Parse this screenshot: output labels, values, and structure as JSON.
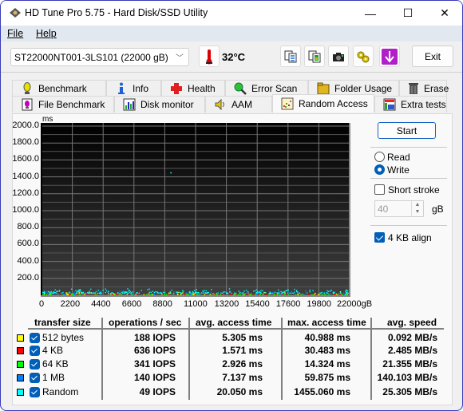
{
  "window": {
    "title": "HD Tune Pro 5.75 - Hard Disk/SSD Utility",
    "controls": {
      "minimize": "—",
      "maximize": "☐",
      "close": "✕"
    }
  },
  "menu": [
    {
      "label": "File",
      "accel": "F"
    },
    {
      "label": "Help",
      "accel": "H"
    }
  ],
  "toolbar": {
    "drive": "ST22000NT001-3LS101 (22000 gB)",
    "temperature": "32°C",
    "icons": [
      "copy-text-icon",
      "copy-image-icon",
      "screenshot-camera-icon",
      "settings-gears-icon",
      "save-download-icon"
    ],
    "exit_label": "Exit"
  },
  "tabs": {
    "row1": [
      {
        "label": "Benchmark",
        "icon": "benchmark-icon"
      },
      {
        "label": "Info",
        "icon": "info-icon"
      },
      {
        "label": "Health",
        "icon": "health-icon"
      },
      {
        "label": "Error Scan",
        "icon": "error-scan-icon"
      },
      {
        "label": "Folder Usage",
        "icon": "folder-icon"
      },
      {
        "label": "Erase",
        "icon": "trash-icon"
      }
    ],
    "row2": [
      {
        "label": "File Benchmark",
        "icon": "file-benchmark-icon"
      },
      {
        "label": "Disk monitor",
        "icon": "disk-monitor-icon"
      },
      {
        "label": "AAM",
        "icon": "speaker-icon"
      },
      {
        "label": "Random Access",
        "icon": "random-access-icon",
        "active": true
      },
      {
        "label": "Extra tests",
        "icon": "extra-tests-icon"
      }
    ]
  },
  "controls": {
    "start_label": "Start",
    "mode_options": [
      {
        "label": "Read",
        "selected": false
      },
      {
        "label": "Write",
        "selected": true
      }
    ],
    "short_stroke": {
      "label": "Short stroke",
      "checked": false
    },
    "short_stroke_value": "40",
    "short_stroke_unit": "gB",
    "align_4kb": {
      "label": "4 KB align",
      "checked": true
    }
  },
  "chart_data": {
    "type": "scatter",
    "title": "",
    "ylabel": "ms",
    "xlabel": "gB",
    "ylim": [
      0,
      2000
    ],
    "xlim": [
      0,
      22000
    ],
    "y_ticks": [
      "2000.0",
      "1800.0",
      "1600.0",
      "1400.0",
      "1200.0",
      "1000.0",
      "800.0",
      "600.0",
      "400.0",
      "200.0"
    ],
    "x_ticks": [
      "0",
      "2200",
      "4400",
      "6600",
      "8800",
      "11000",
      "13200",
      "15400",
      "17600",
      "19800",
      "22000gB"
    ],
    "grid": true,
    "series": [
      {
        "name": "512 bytes",
        "color": "#ffff00",
        "typical_ms": 5.3,
        "max_ms": 41.0
      },
      {
        "name": "4 KB",
        "color": "#ff0000",
        "typical_ms": 1.6,
        "max_ms": 30.5
      },
      {
        "name": "64 KB",
        "color": "#00ff00",
        "typical_ms": 2.9,
        "max_ms": 14.3
      },
      {
        "name": "1 MB",
        "color": "#0080ff",
        "typical_ms": 7.1,
        "max_ms": 59.9
      },
      {
        "name": "Random",
        "color": "#00ffff",
        "typical_ms": 20.1,
        "max_ms": 1455.1
      }
    ],
    "outliers": [
      {
        "series": "Random",
        "x": 9200,
        "y": 1455
      }
    ]
  },
  "results": {
    "headers": [
      "transfer size",
      "operations / sec",
      "avg. access time",
      "max. access time",
      "avg. speed"
    ],
    "rows": [
      {
        "size": "512 bytes",
        "color": "#ffff00",
        "checked": true,
        "ops": "188 IOPS",
        "avg": "5.305 ms",
        "max": "40.988 ms",
        "speed": "0.092 MB/s"
      },
      {
        "size": "4 KB",
        "color": "#ff0000",
        "checked": true,
        "ops": "636 IOPS",
        "avg": "1.571 ms",
        "max": "30.483 ms",
        "speed": "2.485 MB/s"
      },
      {
        "size": "64 KB",
        "color": "#00ff00",
        "checked": true,
        "ops": "341 IOPS",
        "avg": "2.926 ms",
        "max": "14.324 ms",
        "speed": "21.355 MB/s"
      },
      {
        "size": "1 MB",
        "color": "#0080ff",
        "checked": true,
        "ops": "140 IOPS",
        "avg": "7.137 ms",
        "max": "59.875 ms",
        "speed": "140.103 MB/s"
      },
      {
        "size": "Random",
        "color": "#00ffff",
        "checked": true,
        "ops": "49 IOPS",
        "avg": "20.050 ms",
        "max": "1455.060 ms",
        "speed": "25.305 MB/s"
      }
    ]
  }
}
